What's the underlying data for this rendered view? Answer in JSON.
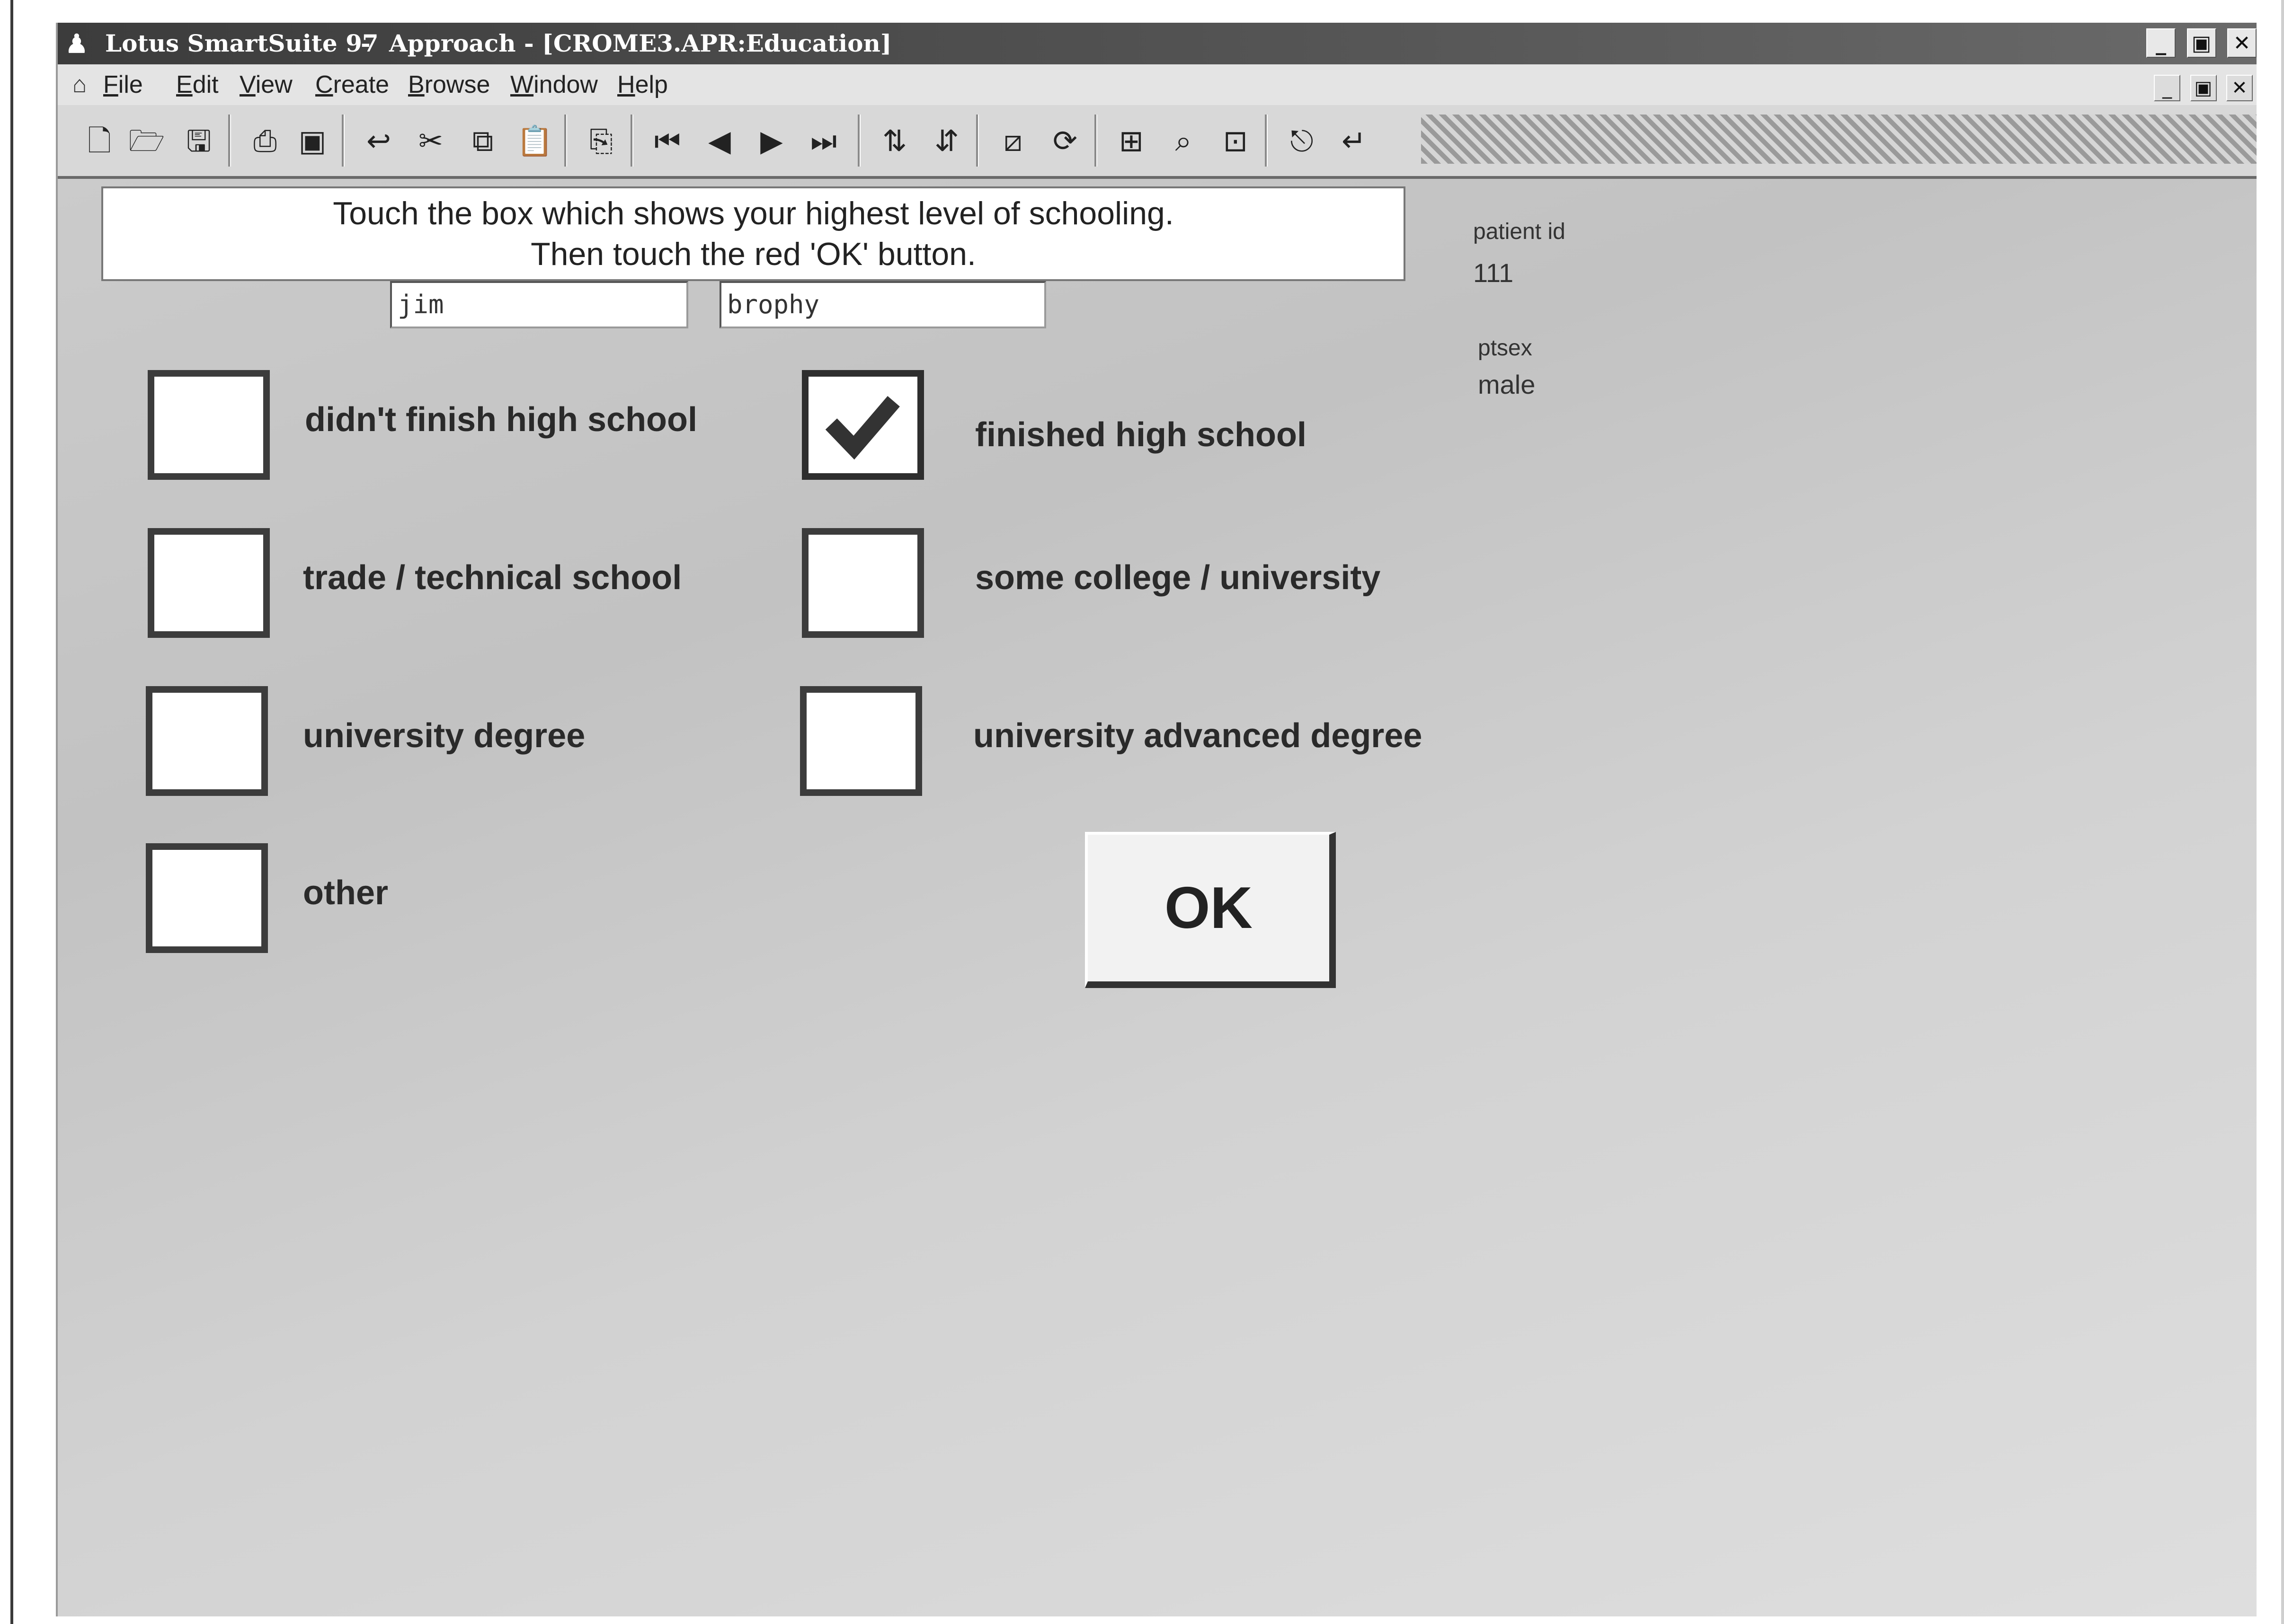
{
  "window": {
    "title_app": "Lotus SmartSuite 97",
    "title_separator": "-",
    "title_doc": "Approach - [CROME3.APR:Education]",
    "controls": {
      "minimize": "_",
      "restore": "▣",
      "close": "✕"
    }
  },
  "menu": {
    "items": [
      {
        "label": "File",
        "key": "F",
        "rest": "ile"
      },
      {
        "label": "Edit",
        "key": "E",
        "rest": "dit"
      },
      {
        "label": "View",
        "key": "V",
        "rest": "iew"
      },
      {
        "label": "Create",
        "key": "C",
        "rest": "reate"
      },
      {
        "label": "Browse",
        "key": "B",
        "rest": "rowse"
      },
      {
        "label": "Window",
        "key": "W",
        "rest": "indow"
      },
      {
        "label": "Help",
        "key": "H",
        "rest": "elp"
      }
    ],
    "mdi_controls": {
      "minimize": "_",
      "restore": "▣",
      "close": "✕"
    }
  },
  "toolbar": {
    "icons": [
      "new-file-icon",
      "open-file-icon",
      "save-icon",
      "print-icon",
      "preview-icon",
      "undo-icon",
      "cut-icon",
      "copy-icon",
      "paste-icon",
      "new-record-icon",
      "first-record-icon",
      "previous-record-icon",
      "next-record-icon",
      "last-record-icon",
      "sort-ascending-icon",
      "sort-descending-icon",
      "draw-icon",
      "refresh-icon",
      "insert-icon",
      "find-icon",
      "find-all-icon",
      "esc-icon",
      "enter-icon"
    ]
  },
  "form": {
    "instructions_line1": "Touch the box which shows your highest level of  schooling.",
    "instructions_line2": "Then touch the red  'OK'  button.",
    "first_name": "jim",
    "last_name": "brophy",
    "patient_id_label": "patient id",
    "patient_id_value": "111",
    "ptsex_label": "ptsex",
    "ptsex_value": "male",
    "options": [
      {
        "label": "didn't finish high school",
        "checked": false
      },
      {
        "label": "finished high school",
        "checked": true
      },
      {
        "label": "trade / technical school",
        "checked": false
      },
      {
        "label": "some college / university",
        "checked": false
      },
      {
        "label": "university degree",
        "checked": false
      },
      {
        "label": "university advanced degree",
        "checked": false
      },
      {
        "label": "other",
        "checked": false
      }
    ],
    "ok_label": "OK"
  }
}
